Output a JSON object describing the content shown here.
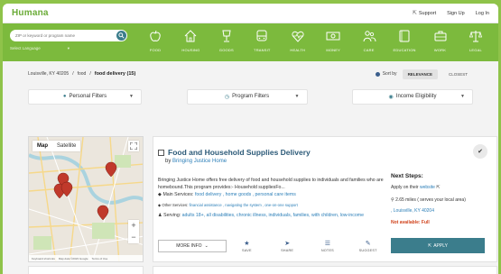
{
  "header": {
    "logo": "Humana",
    "support": "Support",
    "signup": "Sign Up",
    "login": "Log In"
  },
  "search": {
    "placeholder": "ZIP or keyword or program name",
    "language": "Select Language"
  },
  "categories": [
    {
      "label": "FOOD",
      "icon": "apple-icon"
    },
    {
      "label": "HOUSING",
      "icon": "house-icon"
    },
    {
      "label": "GOODS",
      "icon": "lamp-icon"
    },
    {
      "label": "TRANSIT",
      "icon": "bus-icon"
    },
    {
      "label": "HEALTH",
      "icon": "heart-pulse-icon"
    },
    {
      "label": "MONEY",
      "icon": "money-icon"
    },
    {
      "label": "CARE",
      "icon": "people-icon"
    },
    {
      "label": "EDUCATION",
      "icon": "book-icon"
    },
    {
      "label": "WORK",
      "icon": "briefcase-icon"
    },
    {
      "label": "LEGAL",
      "icon": "scales-icon"
    }
  ],
  "breadcrumb": {
    "location": "Louisville, KY 40205",
    "sep1": "/",
    "category": "food",
    "sep2": "/",
    "current": "food delivery (15)"
  },
  "sort": {
    "label": "Sort by",
    "options": [
      "RELEVANCE",
      "CLOSEST"
    ],
    "selected": "RELEVANCE"
  },
  "filters": {
    "personal": "Personal Filters",
    "program": "Program Filters",
    "income": "Income Eligibility"
  },
  "map": {
    "tab_map": "Map",
    "tab_satellite": "Satellite",
    "footer_left": "Keyboard shortcuts",
    "footer_mid": "Map data ©2023 Google",
    "footer_right": "Terms of Use"
  },
  "result": {
    "title": "Food and Household Supplies Delivery",
    "by": "by",
    "provider": "Bringing Justice Home",
    "description": "Bringing Justice Home offers free delivery of food and household supplies to individuals and families who are homebound.This program provides:- Household suppliesFo...",
    "main_services_label": "Main Services:",
    "main_services": "food delivery , home goods , personal care items",
    "other_services_label": "Other Services:",
    "other_services": "financial assistance , navigating the system , one-on-one support",
    "serving_label": "Serving:",
    "serving": "adults 18+, all disabilities, chronic illness, individuals, families, with children, low-income",
    "more_info": "MORE INFO",
    "actions": [
      "SAVE",
      "SHARE",
      "NOTES",
      "SUGGEST"
    ],
    "next_steps": {
      "title": "Next Steps:",
      "apply_on": "Apply on their",
      "website": "website",
      "distance": "2.65 miles ( serves your local area)",
      "address": ", Louisville, KY 40204",
      "availability": "Not available: Full"
    },
    "apply_button": "APPLY"
  }
}
